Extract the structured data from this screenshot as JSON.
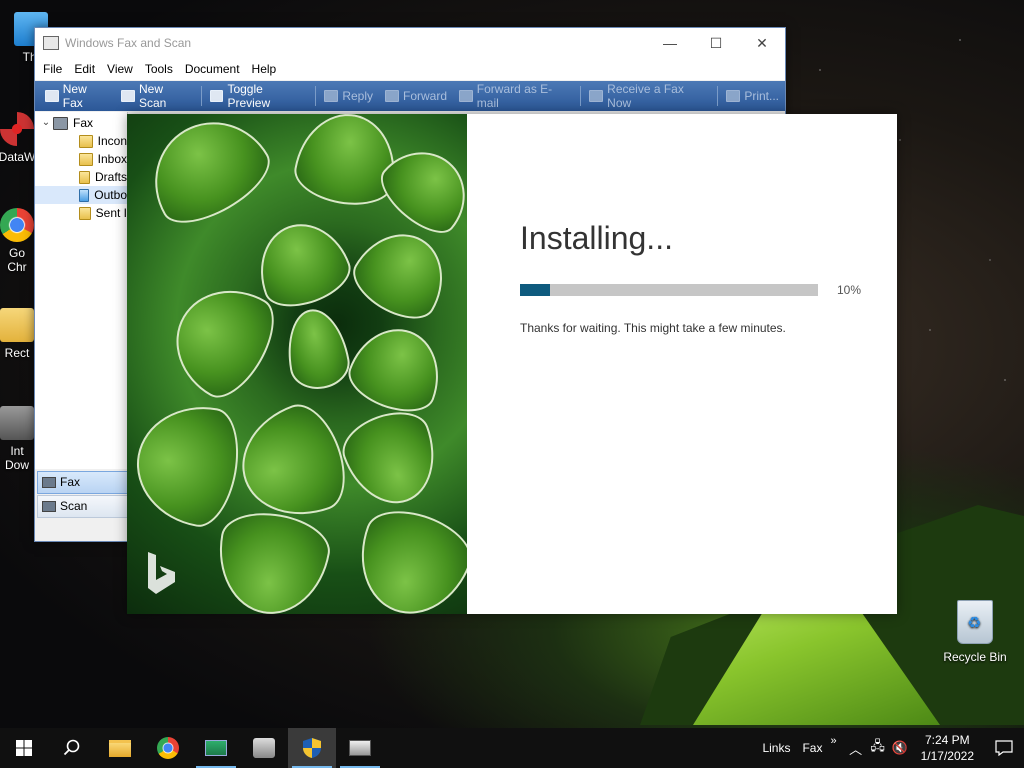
{
  "fax_window": {
    "title": "Windows Fax and Scan",
    "controls": {
      "minimize": "—",
      "maximize": "☐",
      "close": "✕"
    },
    "menu": [
      "File",
      "Edit",
      "View",
      "Tools",
      "Document",
      "Help"
    ],
    "toolbar": {
      "new_fax": "New Fax",
      "new_scan": "New Scan",
      "toggle_preview": "Toggle Preview",
      "reply": "Reply",
      "forward": "Forward",
      "forward_email": "Forward as E-mail",
      "receive_fax": "Receive a Fax Now",
      "print": "Print..."
    },
    "tree": {
      "root": "Fax",
      "items": [
        "Incon",
        "Inbox",
        "Drafts",
        "Outbo",
        "Sent I"
      ]
    },
    "nav": {
      "fax": "Fax",
      "scan": "Scan"
    }
  },
  "installer": {
    "title": "Installing...",
    "progress_percent_label": "10%",
    "progress_value": 0.1,
    "message": "Thanks for waiting. This might take a few minutes."
  },
  "desktop": {
    "icons": [
      {
        "label": "Thi"
      },
      {
        "label": "DataW"
      },
      {
        "label": "Go\nChr"
      },
      {
        "label": "Rect"
      },
      {
        "label": "Int\nDow"
      }
    ],
    "recycle_bin": "Recycle Bin"
  },
  "taskbar": {
    "links": "Links",
    "fax": "Fax",
    "overflow": "»",
    "time": "7:24 PM",
    "date": "1/17/2022"
  },
  "colors": {
    "toolbar_blue": "#2b5797",
    "progress_fill": "#0e5a7e",
    "progress_track": "#c6c6c6"
  }
}
